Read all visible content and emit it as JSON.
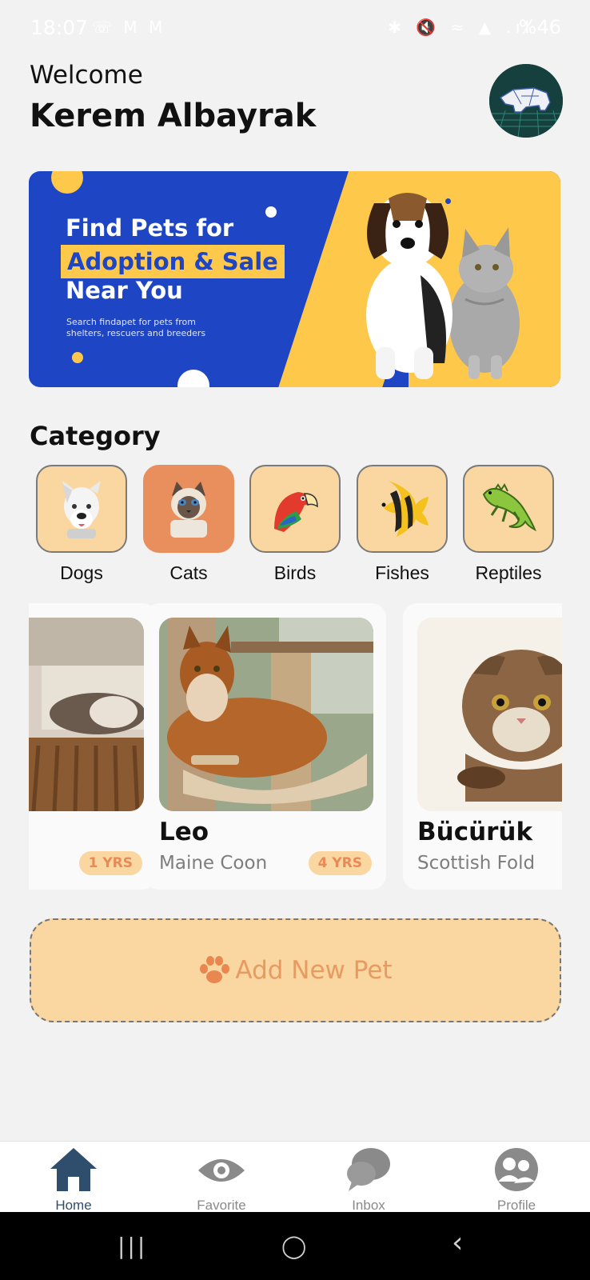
{
  "status": {
    "time": "18:07",
    "left_icons": "☏ M M",
    "right_icons": "✱ 🔇 ≈ ▲ .ıl",
    "battery": "%46"
  },
  "header": {
    "welcome": "Welcome",
    "user_name": "Kerem Albayrak"
  },
  "banner": {
    "line1": "Find Pets for",
    "line2": "Adoption & Sale",
    "line3": "Near You",
    "sub": "Search findapet for pets from shelters, rescuers and breeders"
  },
  "category": {
    "title": "Category",
    "items": [
      {
        "label": "Dogs",
        "icon": "dog-icon"
      },
      {
        "label": "Cats",
        "icon": "cat-icon"
      },
      {
        "label": "Birds",
        "icon": "bird-icon"
      },
      {
        "label": "Fishes",
        "icon": "fish-icon"
      },
      {
        "label": "Reptiles",
        "icon": "reptile-icon"
      }
    ],
    "selected": "Cats"
  },
  "pets": [
    {
      "name": "",
      "breed": "",
      "age": "1 YRS"
    },
    {
      "name": "Leo",
      "breed": "Maine Coon",
      "age": "4 YRS"
    },
    {
      "name": "Bücürük",
      "breed": "Scottish Fold",
      "age": ""
    }
  ],
  "add_pet": {
    "label": "Add New Pet",
    "icon": "paw-icon"
  },
  "nav": {
    "items": [
      {
        "label": "Home",
        "icon": "home-icon"
      },
      {
        "label": "Favorite",
        "icon": "eye-icon"
      },
      {
        "label": "Inbox",
        "icon": "chat-icon"
      },
      {
        "label": "Profile",
        "icon": "profile-icon"
      }
    ],
    "active": "Home"
  },
  "system_nav": {
    "recent": "|||",
    "home": "◯",
    "back": "‹"
  },
  "colors": {
    "banner_blue": "#1d45c4",
    "banner_yellow": "#fec84b",
    "tile": "#fad7a0",
    "tile_active": "#e98f5e",
    "accent": "#e89a63",
    "nav_active": "#2f4e6e"
  }
}
